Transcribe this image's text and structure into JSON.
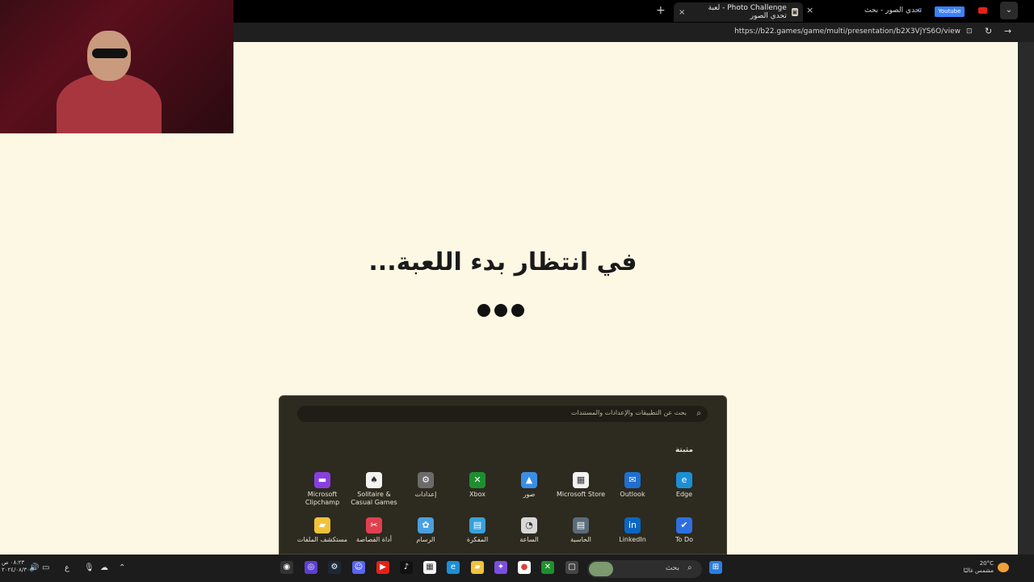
{
  "browser": {
    "active_tab_title": "Photo Challenge - لعبة تحدي الصور",
    "new_tab": "+",
    "close_glyph": "×",
    "search_tab_text": "تحدي الصور - بحث",
    "youtube_badge": "Youtube",
    "url": "https://b22.games/game/multi/presentation/b2X3VjYS6O/view",
    "chevron": "⌄"
  },
  "game": {
    "waiting_text": "في انتظار بدء اللعبة..."
  },
  "start_menu": {
    "search_placeholder": "بحث عن التطبيقات والإعدادات والمستندات",
    "pinned_label": "مثبتة",
    "apps": [
      {
        "label": "Edge",
        "icon": "edge-icon",
        "color": "#1b8fd6"
      },
      {
        "label": "Outlook",
        "icon": "outlook-icon",
        "color": "#1f6fd0"
      },
      {
        "label": "Microsoft Store",
        "icon": "store-icon",
        "color": "#f3f3f3"
      },
      {
        "label": "صور",
        "icon": "photos-icon",
        "color": "#3a8ee6"
      },
      {
        "label": "Xbox",
        "icon": "xbox-icon",
        "color": "#1e8f2e"
      },
      {
        "label": "إعدادات",
        "icon": "settings-icon",
        "color": "#6b6b6b"
      },
      {
        "label": "Solitaire & Casual Games",
        "icon": "solitaire-icon",
        "color": "#f3f3f3"
      },
      {
        "label": "Microsoft Clipchamp",
        "icon": "clipchamp-icon",
        "color": "#8a3ee0"
      },
      {
        "label": "To Do",
        "icon": "todo-icon",
        "color": "#2e6fe0"
      },
      {
        "label": "LinkedIn",
        "icon": "linkedin-icon",
        "color": "#0a66c2"
      },
      {
        "label": "الحاسبة",
        "icon": "calculator-icon",
        "color": "#5a6b7a"
      },
      {
        "label": "الساعة",
        "icon": "clock-icon",
        "color": "#d8d8d8"
      },
      {
        "label": "المفكرة",
        "icon": "notepad-icon",
        "color": "#3aa0d8"
      },
      {
        "label": "الرسام",
        "icon": "paint-icon",
        "color": "#4aa0e0"
      },
      {
        "label": "أداة القصاصة",
        "icon": "snipping-tool-icon",
        "color": "#e04050"
      },
      {
        "label": "مستكشف الملفات",
        "icon": "file-explorer-icon",
        "color": "#f2c23a"
      }
    ]
  },
  "taskbar": {
    "search_text": "بحث",
    "clock_time": "٠٨:٢٣ ص",
    "clock_date": "٢٠٢٤/٠٨/٣٠",
    "weather_temp": "20°C",
    "weather_desc": "مشمس غالبًا",
    "lang": "ع"
  }
}
